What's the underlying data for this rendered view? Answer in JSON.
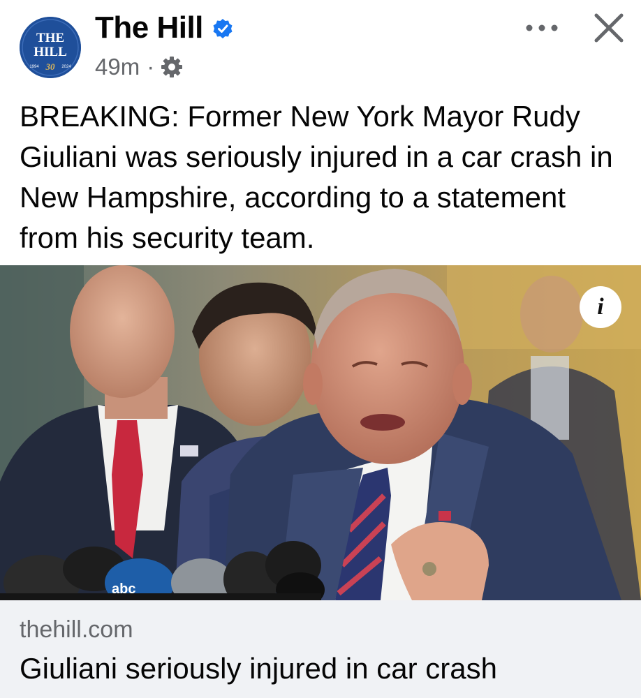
{
  "header": {
    "page_name": "The Hill",
    "timestamp": "49m",
    "separator": "·",
    "avatar": {
      "line1": "THE",
      "line2": "HILL",
      "year_start": "1994",
      "anniversary": "30",
      "year_end": "2024"
    },
    "icons": {
      "verified": "verified-badge-icon",
      "audience": "gear-icon",
      "more": "more-options-icon",
      "close": "close-icon"
    },
    "colors": {
      "verified": "#1877f2",
      "avatar_bg": "#1f4f9a",
      "meta_text": "#65676b"
    }
  },
  "post": {
    "text": "BREAKING: Former New York Mayor Rudy Giuliani was seriously injured in a car crash in New Hampshire, according to a statement from his security team."
  },
  "photo": {
    "info_label": "i",
    "mic_logo": "abc"
  },
  "link_card": {
    "domain": "thehill.com",
    "title": "Giuliani seriously injured in car crash",
    "background": "#f0f2f5"
  }
}
